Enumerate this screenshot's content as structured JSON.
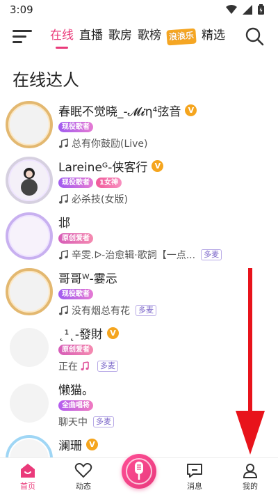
{
  "status": {
    "time": "3:09"
  },
  "nav": {
    "tabs": [
      {
        "label": "在线",
        "active": true
      },
      {
        "label": "直播",
        "active": false
      },
      {
        "label": "歌房",
        "active": false
      },
      {
        "label": "歌榜",
        "active": false
      }
    ],
    "badge_label": "浪浪乐",
    "last_tab": "精选"
  },
  "section_title": "在线达人",
  "users": [
    {
      "name": "春眠不觉晓_-𝓜𝓲η⁴弦音",
      "verified": true,
      "badges": [
        "现役歌者"
      ],
      "song": "总有你鼓励(Live)",
      "multi": ""
    },
    {
      "name": "Lareineᴳ-侠客行",
      "verified": true,
      "badges": [
        "现役歌者",
        "1女神"
      ],
      "song": "必杀技(女版)",
      "multi": ""
    },
    {
      "name": "邶",
      "verified": false,
      "badges": [
        "原创爱者"
      ],
      "song": "辛雯.ᐅ-治愈辑·歌詞【一点...",
      "multi": "多麦"
    },
    {
      "name": "哥哥ᵂ-霎忈",
      "verified": false,
      "badges": [
        "现役歌者"
      ],
      "song": "没有烟总有花",
      "multi": "多麦"
    },
    {
      "name": "˛¹˛-發財",
      "verified": true,
      "badges": [
        "原创爱者"
      ],
      "song": "正在",
      "multi": "多麦"
    },
    {
      "name": "懒猫。",
      "verified": false,
      "badges": [
        "全曲唱将"
      ],
      "song": "聊天中",
      "multi": "多麦"
    },
    {
      "name": "澜珊",
      "verified": true,
      "badges": [],
      "song": "",
      "multi": ""
    }
  ],
  "bottom_nav": [
    {
      "label": "首页",
      "icon": "home-icon",
      "active": true
    },
    {
      "label": "动态",
      "icon": "heart-icon",
      "active": false
    },
    {
      "label": "",
      "icon": "microphone-icon",
      "active": false
    },
    {
      "label": "消息",
      "icon": "message-icon",
      "active": false
    },
    {
      "label": "我的",
      "icon": "profile-icon",
      "active": false
    }
  ],
  "colors": {
    "accent": "#ea3a7a",
    "arrow": "#e8131b",
    "verified": "#f5a51e"
  }
}
